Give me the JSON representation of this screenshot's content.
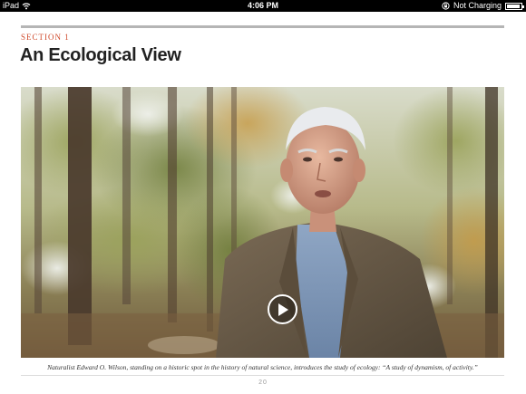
{
  "status_bar": {
    "device": "iPad",
    "time": "4:06 PM",
    "charging": "Not Charging",
    "battery_level": 0.9,
    "icons": [
      "wifi-icon",
      "rotation-lock-icon",
      "battery-icon"
    ]
  },
  "section": {
    "label": "SECTION 1",
    "title": "An Ecological View"
  },
  "video": {
    "play_icon": "play-icon"
  },
  "caption": "Naturalist Edward O. Wilson, standing on a historic spot in the history of natural science, introduces the study of ecology: “A study of dynamism, of activity.”",
  "page_number": "20",
  "colors": {
    "accent": "#cf4a2c",
    "rule": "#b5b5b5",
    "title": "#222222"
  }
}
